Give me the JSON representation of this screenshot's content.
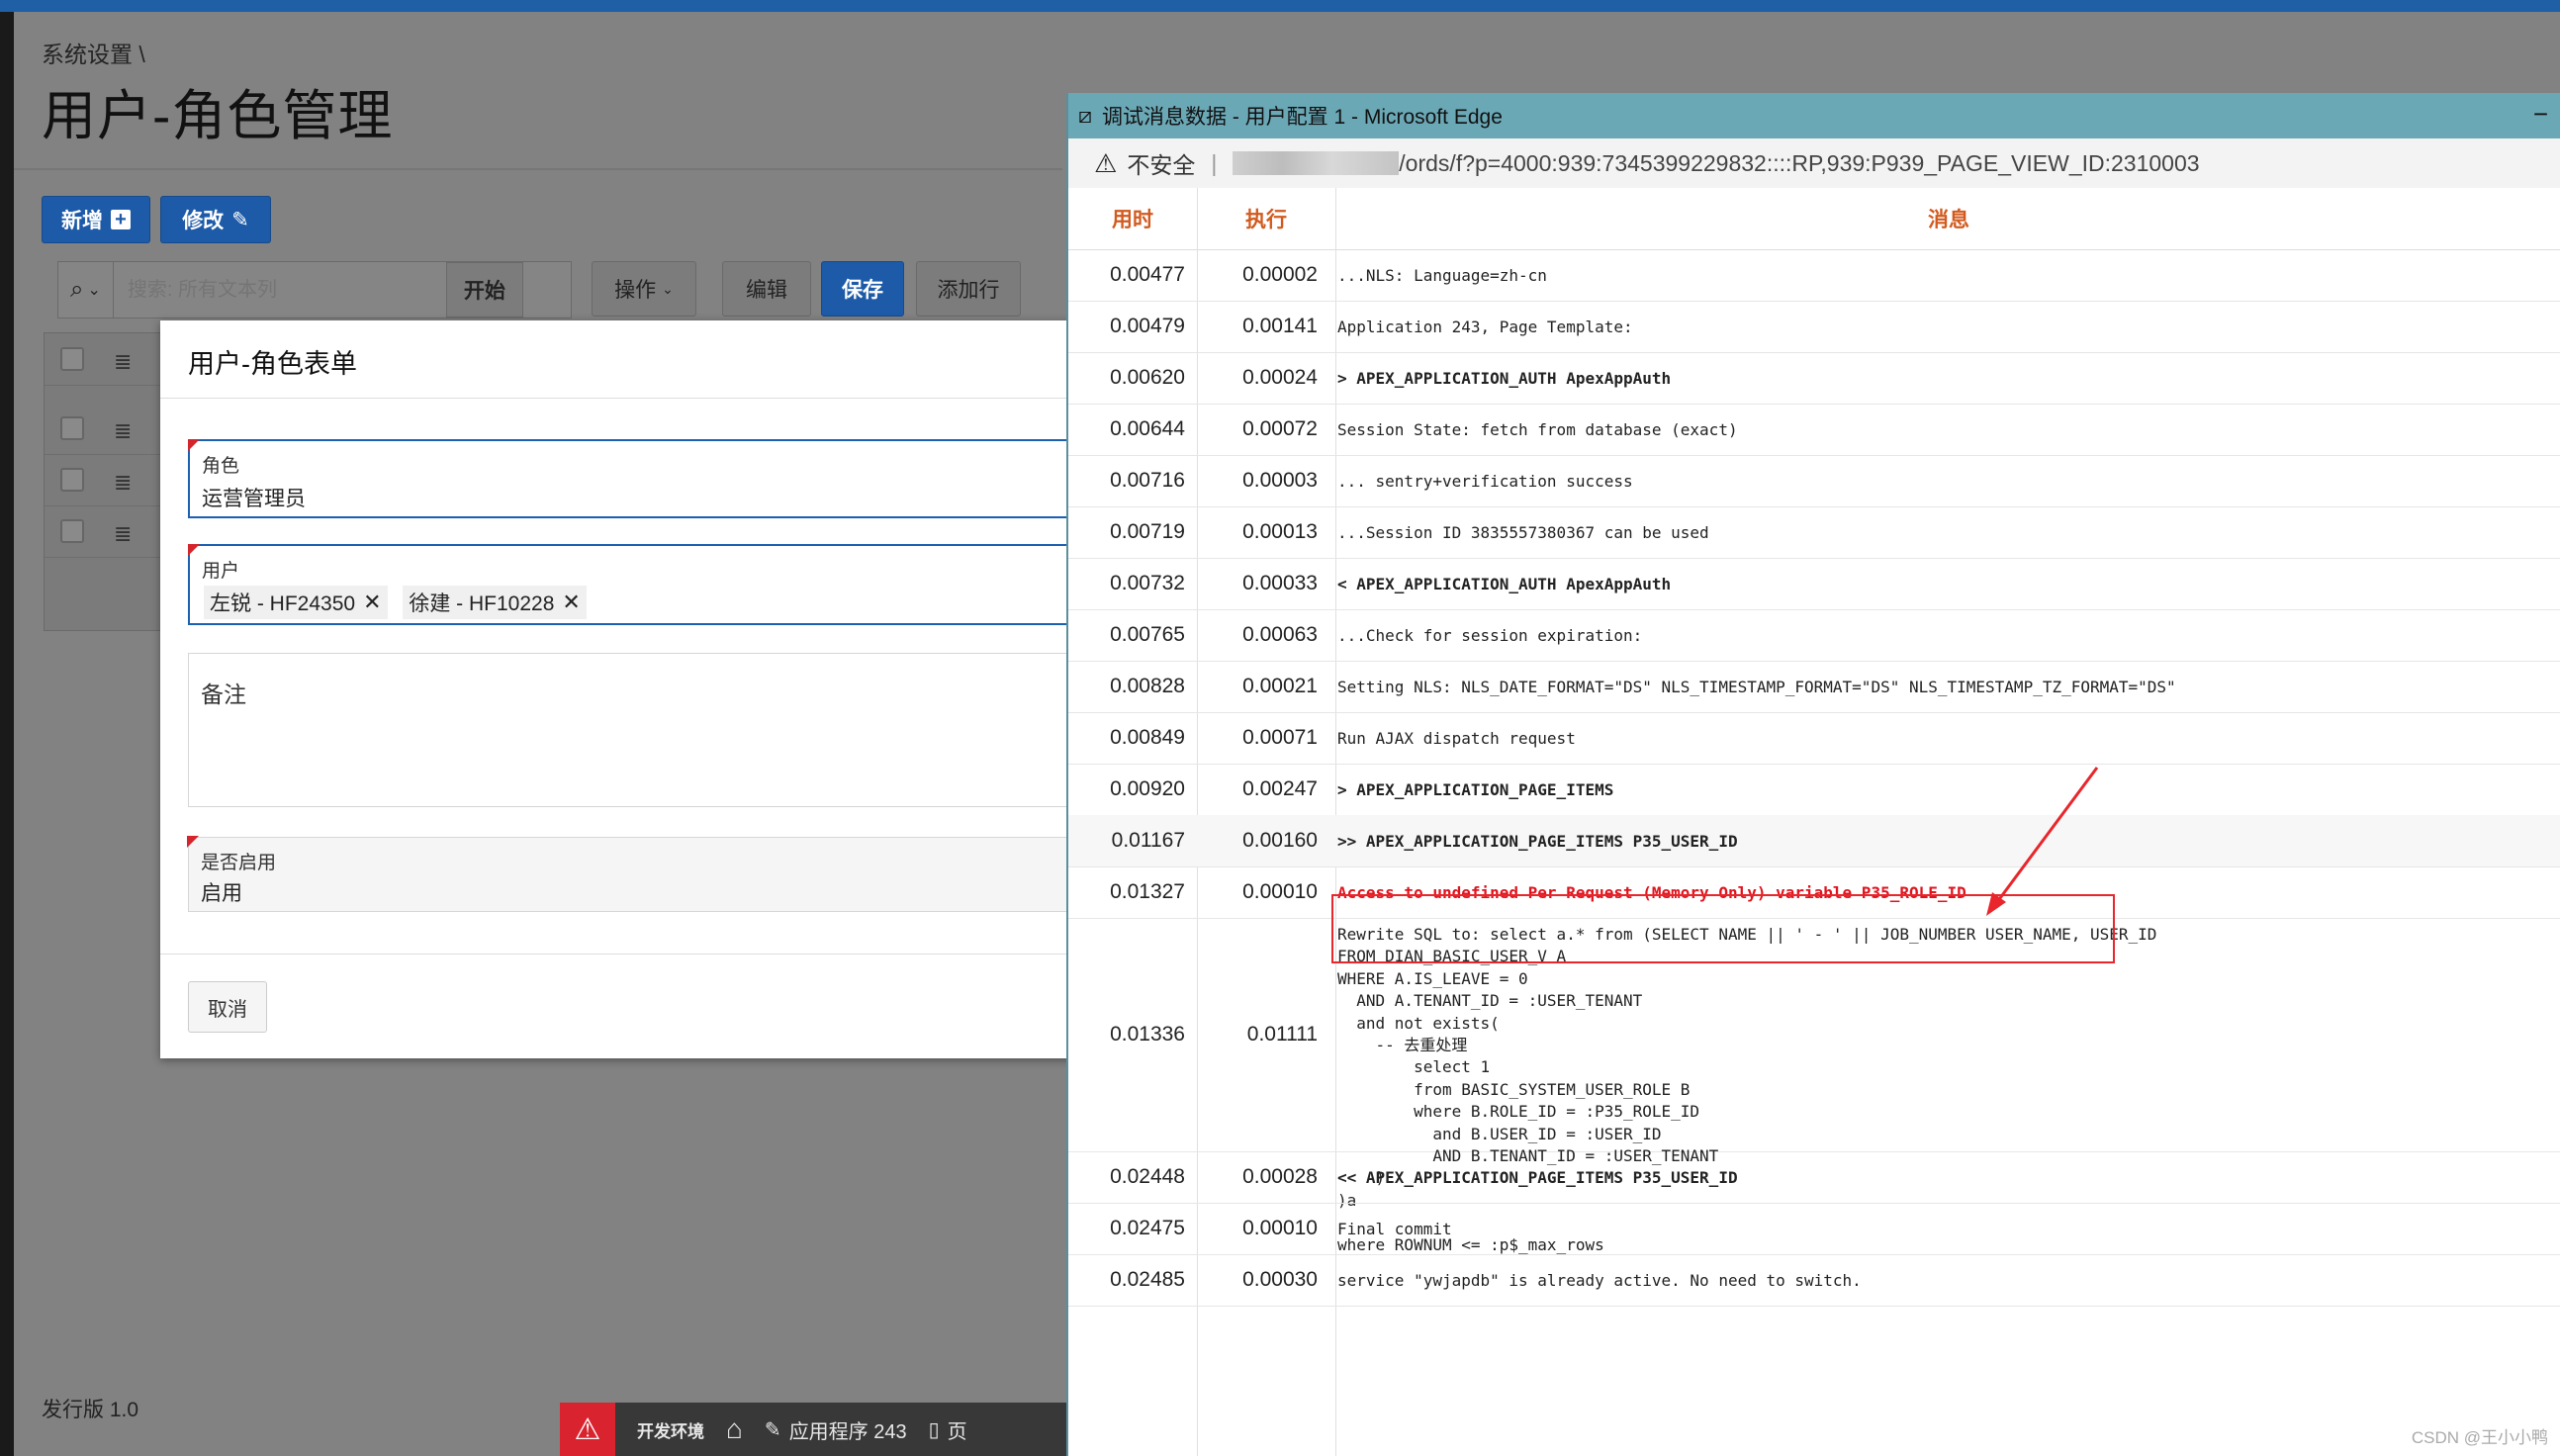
{
  "breadcrumb": "系统设置 \\",
  "page_title": "用户-角色管理",
  "toolbar": {
    "new_label": "新增",
    "edit_label": "修改",
    "search_placeholder": "搜索: 所有文本列",
    "go_label": "开始",
    "actions_label": "操作",
    "edit_btn": "编辑",
    "save_btn": "保存",
    "addrow_btn": "添加行"
  },
  "footer": {
    "version": "发行版 1.0"
  },
  "devbar": {
    "env": "开发环境",
    "app": "应用程序 243",
    "page": "页"
  },
  "dialog": {
    "title": "用户-角色表单",
    "role_label": "角色",
    "role_value": "运营管理员",
    "user_label": "用户",
    "users": [
      "左锐 - HF24350",
      "徐建 - HF10228"
    ],
    "remark_label": "备注",
    "enabled_label": "是否启用",
    "enabled_value": "启用",
    "cancel_label": "取消"
  },
  "popup": {
    "window_title": "调试消息数据 - 用户配置 1 - Microsoft Edge",
    "insecure": "不安全",
    "url": "/ords/f?p=4000:939:7345399229832::::RP,939:P939_PAGE_VIEW_ID:2310003",
    "col_time": "用时",
    "col_exec": "执行",
    "col_msg": "消息",
    "rows": [
      {
        "t": "0.00477",
        "e": "0.00002",
        "m": "...NLS: Language=zh-cn"
      },
      {
        "t": "0.00479",
        "e": "0.00141",
        "m": "Application 243, Page Template:"
      },
      {
        "t": "0.00620",
        "e": "0.00024",
        "m": "> APEX_APPLICATION_AUTH ApexAppAuth"
      },
      {
        "t": "0.00644",
        "e": "0.00072",
        "m": "Session State: fetch from database (exact)"
      },
      {
        "t": "0.00716",
        "e": "0.00003",
        "m": "... sentry+verification success"
      },
      {
        "t": "0.00719",
        "e": "0.00013",
        "m": "...Session ID 3835557380367 can be used"
      },
      {
        "t": "0.00732",
        "e": "0.00033",
        "m": "< APEX_APPLICATION_AUTH ApexAppAuth"
      },
      {
        "t": "0.00765",
        "e": "0.00063",
        "m": "...Check for session expiration:"
      },
      {
        "t": "0.00828",
        "e": "0.00021",
        "m": "Setting NLS: NLS_DATE_FORMAT=\"DS\" NLS_TIMESTAMP_FORMAT=\"DS\" NLS_TIMESTAMP_TZ_FORMAT=\"DS\""
      },
      {
        "t": "0.00849",
        "e": "0.00071",
        "m": "Run AJAX dispatch request"
      },
      {
        "t": "0.00920",
        "e": "0.00247",
        "m": "> APEX_APPLICATION_PAGE_ITEMS"
      },
      {
        "t": "0.01167",
        "e": "0.00160",
        "m": ">> APEX_APPLICATION_PAGE_ITEMS P35_USER_ID"
      },
      {
        "t": "0.01327",
        "e": "0.00010",
        "m": "Access to undefined Per Request (Memory Only) variable P35_ROLE_ID"
      },
      {
        "t": "0.01336",
        "e": "0.01111",
        "m": "Rewrite SQL to: select a.* from (SELECT NAME || ' - ' || JOB_NUMBER USER_NAME, USER_ID\nFROM DIAN_BASIC_USER_V A\nWHERE A.IS_LEAVE = 0\n  AND A.TENANT_ID = :USER_TENANT\n  and not exists(\n    -- 去重处理\n        select 1\n        from BASIC_SYSTEM_USER_ROLE B\n        where B.ROLE_ID = :P35_ROLE_ID\n          and B.USER_ID = :USER_ID\n          AND B.TENANT_ID = :USER_TENANT\n    )\n)a\n\nwhere ROWNUM <= :p$_max_rows"
      },
      {
        "t": "0.02448",
        "e": "0.00028",
        "m": "<< APEX_APPLICATION_PAGE_ITEMS P35_USER_ID"
      },
      {
        "t": "0.02475",
        "e": "0.00010",
        "m": "Final commit"
      },
      {
        "t": "0.02485",
        "e": "0.00030",
        "m": "service \"ywjapdb\" is already active. No need to switch."
      }
    ]
  },
  "watermark": "CSDN @王小小鸭"
}
